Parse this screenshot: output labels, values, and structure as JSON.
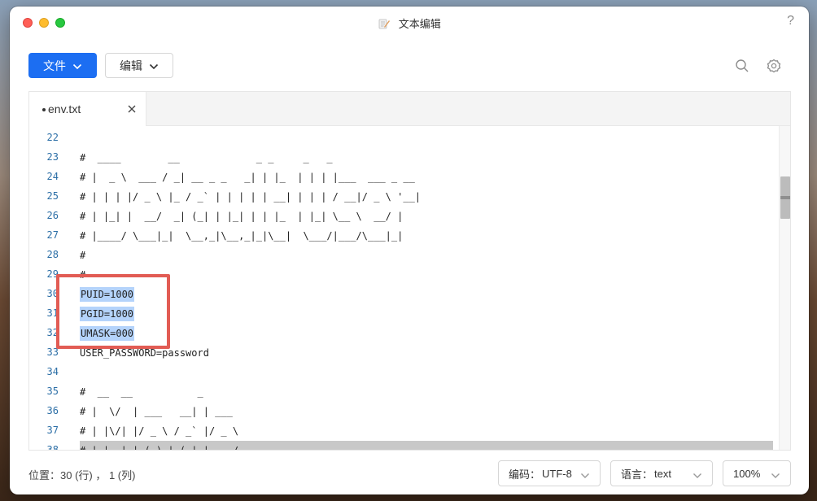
{
  "window": {
    "title": "文本编辑",
    "help_label": "?"
  },
  "toolbar": {
    "file_label": "文件",
    "edit_label": "编辑"
  },
  "tab": {
    "label": "env.txt",
    "modified": true
  },
  "editor": {
    "lines": [
      {
        "num": "22",
        "text": ""
      },
      {
        "num": "23",
        "text": "#  ____        __             _ _     _   _"
      },
      {
        "num": "24",
        "text": "# |  _ \\  ___ / _| __ _ _   _| | |_  | | | |___  ___ _ __"
      },
      {
        "num": "25",
        "text": "# | | | |/ _ \\ |_ / _` | | | | | __| | | | / __|/ _ \\ '__|"
      },
      {
        "num": "26",
        "text": "# | |_| |  __/  _| (_| | |_| | | |_  | |_| \\__ \\  __/ |"
      },
      {
        "num": "27",
        "text": "# |____/ \\___|_|  \\__,_|\\__,_|_|\\__|  \\___/|___/\\___|_|"
      },
      {
        "num": "28",
        "text": "#"
      },
      {
        "num": "29",
        "text": "#"
      },
      {
        "num": "30",
        "text": "PUID=1000"
      },
      {
        "num": "31",
        "text": "PGID=1000"
      },
      {
        "num": "32",
        "text": "UMASK=000"
      },
      {
        "num": "33",
        "text": "USER_PASSWORD=password"
      },
      {
        "num": "34",
        "text": ""
      },
      {
        "num": "35",
        "text": "#  __  __           _"
      },
      {
        "num": "36",
        "text": "# |  \\/  | ___   __| | ___"
      },
      {
        "num": "37",
        "text": "# | |\\/| |/ _ \\ / _` |/ _ \\"
      },
      {
        "num": "38",
        "text": "# | |  | | (_) | (_| |  __/"
      }
    ],
    "selected_lines": [
      "30",
      "31",
      "32"
    ],
    "highlighted_line": "38"
  },
  "statusbar": {
    "position": "位置：30 (行) ， 1 (列)",
    "encoding_label": "编码：",
    "encoding_value": "UTF-8",
    "language_label": "语言：",
    "language_value": "text",
    "zoom_value": "100%"
  },
  "colors": {
    "accent": "#1c6ef2",
    "selection": "#b4d3fb",
    "annotation": "#e25c54",
    "line_number": "#2b6ea6"
  }
}
